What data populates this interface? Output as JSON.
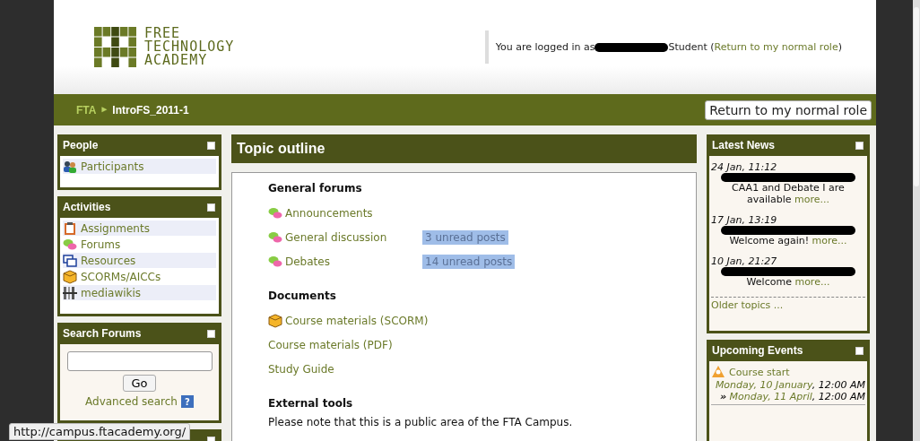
{
  "logo": {
    "lines": [
      "FREE",
      "TECHNOLOGY",
      "ACADEMY"
    ]
  },
  "login": {
    "prefix": "You are logged in as",
    "suffix": "Student (",
    "link": "Return to my normal role",
    "end": ")"
  },
  "breadcrumb": {
    "items": [
      "FTA",
      "IntroFS_2011-1"
    ],
    "separator": "►"
  },
  "role_button": "Return to my normal role",
  "left_blocks": [
    {
      "kind": "list",
      "title": "People",
      "items": [
        {
          "label": "Participants",
          "kind": "people"
        }
      ]
    },
    {
      "kind": "list",
      "title": "Activities",
      "items": [
        {
          "label": "Assignments",
          "kind": "assignment"
        },
        {
          "label": "Forums",
          "kind": "forum"
        },
        {
          "label": "Resources",
          "kind": "resource"
        },
        {
          "label": "SCORMs/AICCs",
          "kind": "scorm"
        },
        {
          "label": "mediawikis",
          "kind": "wiki"
        }
      ]
    },
    {
      "kind": "search",
      "title": "Search Forums",
      "button": "Go",
      "link": "Advanced search",
      "help": "?"
    },
    {
      "kind": "cut"
    }
  ],
  "topic": {
    "title": "Topic outline",
    "sections": [
      {
        "heading": "General forums",
        "items": [
          {
            "label": "Announcements",
            "kind": "forum"
          },
          {
            "label": "General discussion",
            "kind": "forum",
            "badge": "3 unread posts"
          },
          {
            "label": "Debates",
            "kind": "forum",
            "badge": "14 unread posts"
          }
        ]
      },
      {
        "heading": "Documents",
        "items": [
          {
            "label": "Course materials (SCORM)",
            "kind": "scorm"
          },
          {
            "label": "Course materials (PDF)",
            "kind": "page"
          },
          {
            "label": "Study Guide",
            "kind": "page"
          }
        ]
      },
      {
        "heading": "External tools",
        "text": "Please note that this is a public area of the FTA Campus."
      }
    ]
  },
  "news": {
    "title": "Latest News",
    "items": [
      {
        "date": "24 Jan, 11:12",
        "text": "CAA1 and Debate I are available",
        "more": "more..."
      },
      {
        "date": "17 Jan, 13:19",
        "text": "Welcome again!",
        "more": "more..."
      },
      {
        "date": "10 Jan, 21:27",
        "text": "Welcome",
        "more": "more..."
      }
    ],
    "older": "Older topics ..."
  },
  "events": {
    "title": "Upcoming Events",
    "items": [
      {
        "name": "Course start",
        "start_day": "Monday, 10 January",
        "start_time": ", 12:00 AM",
        "arrow": "»",
        "end_day": "Monday, 11 April",
        "end_time": ", 12:00 AM"
      }
    ]
  },
  "status_url": "http://campus.ftacademy.org/"
}
